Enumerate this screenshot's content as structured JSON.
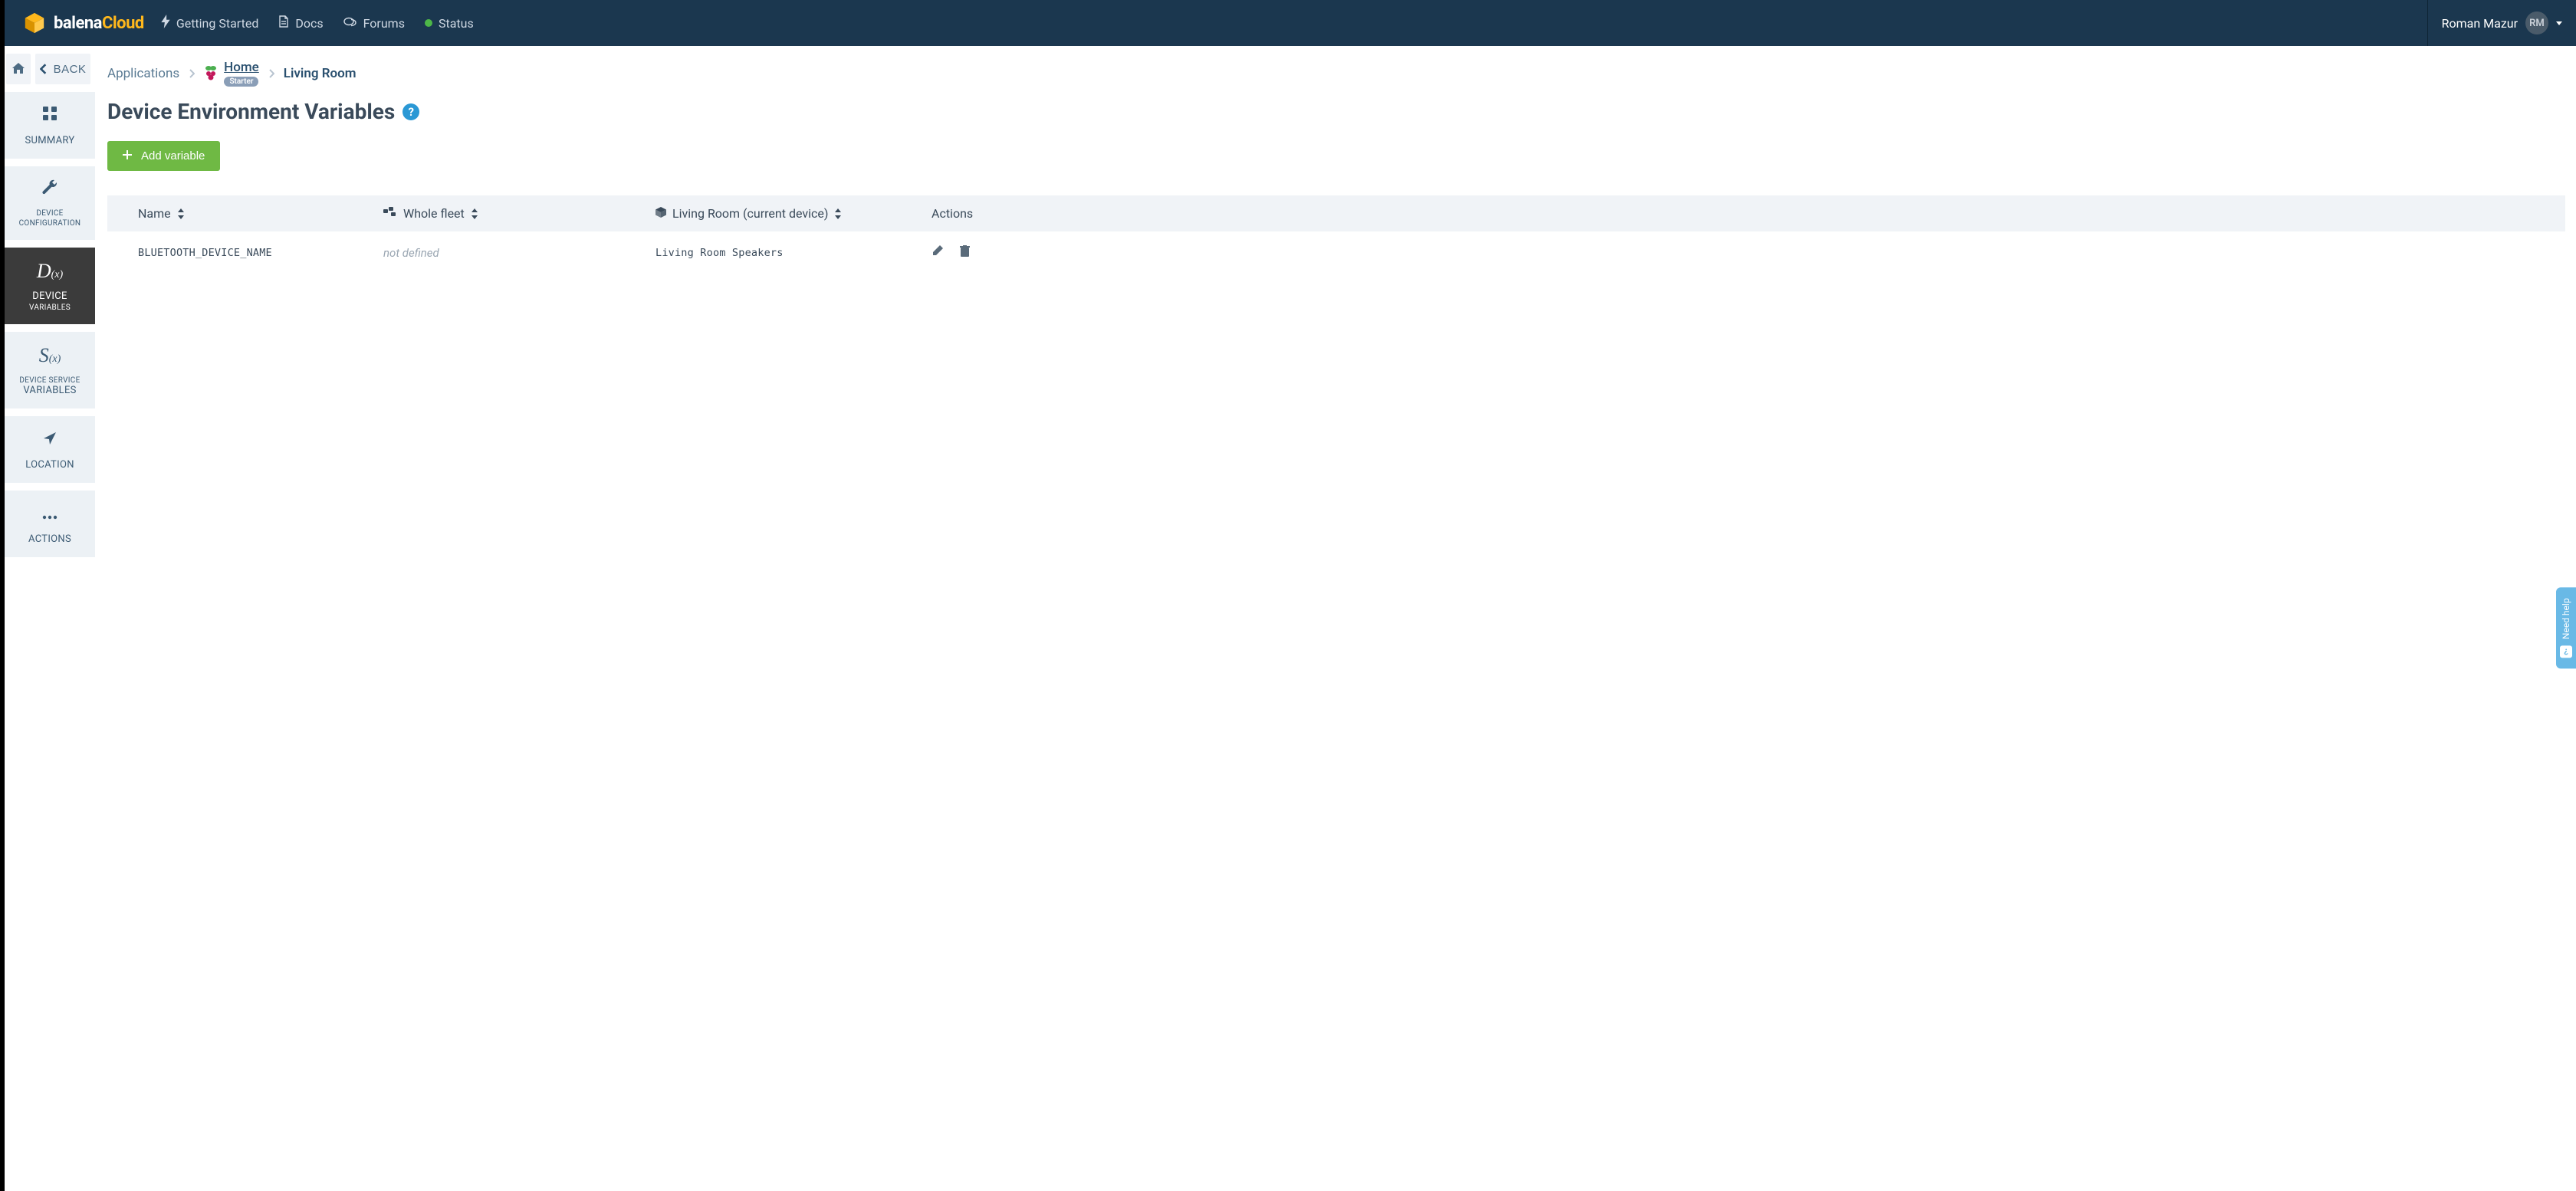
{
  "brand": {
    "name1": "balena",
    "name2": "Cloud"
  },
  "nav": {
    "getting_started": "Getting Started",
    "docs": "Docs",
    "forums": "Forums",
    "status": "Status"
  },
  "user": {
    "name": "Roman Mazur",
    "initials": "RM"
  },
  "back": {
    "label": "BACK"
  },
  "breadcrumbs": {
    "applications": "Applications",
    "home": "Home",
    "home_badge": "Starter",
    "device": "Living Room"
  },
  "page": {
    "title": "Device Environment Variables",
    "add_button": "Add variable"
  },
  "sidebar": {
    "summary": "SUMMARY",
    "device_config_l1": "DEVICE",
    "device_config_l2": "CONFIGURATION",
    "device_vars_l1": "DEVICE",
    "device_vars_l2": "VARIABLES",
    "service_vars_l1": "DEVICE SERVICE",
    "service_vars_l2": "VARIABLES",
    "location": "LOCATION",
    "actions": "ACTIONS"
  },
  "table": {
    "headers": {
      "name": "Name",
      "fleet": "Whole fleet",
      "device": "Living Room (current device)",
      "actions": "Actions"
    },
    "rows": [
      {
        "name": "BLUETOOTH_DEVICE_NAME",
        "fleet": "not defined",
        "device": "Living Room Speakers"
      }
    ]
  },
  "help_tab": "Need help"
}
